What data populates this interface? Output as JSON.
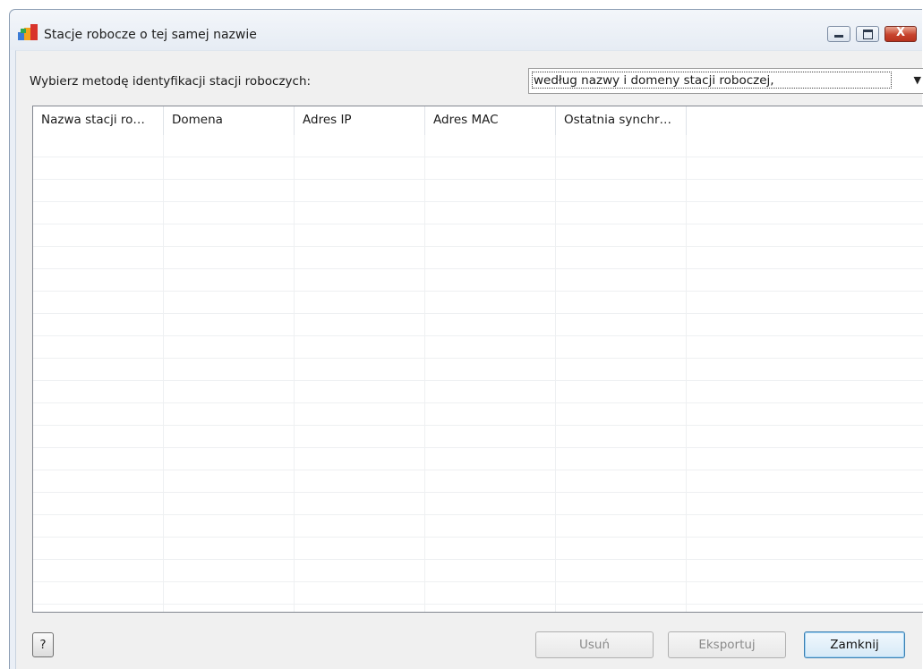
{
  "window": {
    "title": "Stacje robocze o tej samej nazwie",
    "icon": "avg-logo-icon",
    "controls": [
      "minimize-icon",
      "maximize-icon",
      "close-icon"
    ],
    "close_glyph": "X"
  },
  "identification": {
    "label": "Wybierz metodę identyfikacji stacji roboczych:",
    "selected": "według nazwy i domeny stacji roboczej,",
    "arrow": "▼"
  },
  "table": {
    "columns": [
      "Nazwa stacji ro…",
      "Domena",
      "Adres IP",
      "Adres MAC",
      "Ostatnia synchr…"
    ],
    "rows": []
  },
  "buttons": {
    "help": "?",
    "delete": "Usuń",
    "export": "Eksportuj",
    "close": "Zamknij"
  },
  "colors": {
    "close_button": "#c7432d",
    "default_button_border": "#3c7fb1"
  }
}
